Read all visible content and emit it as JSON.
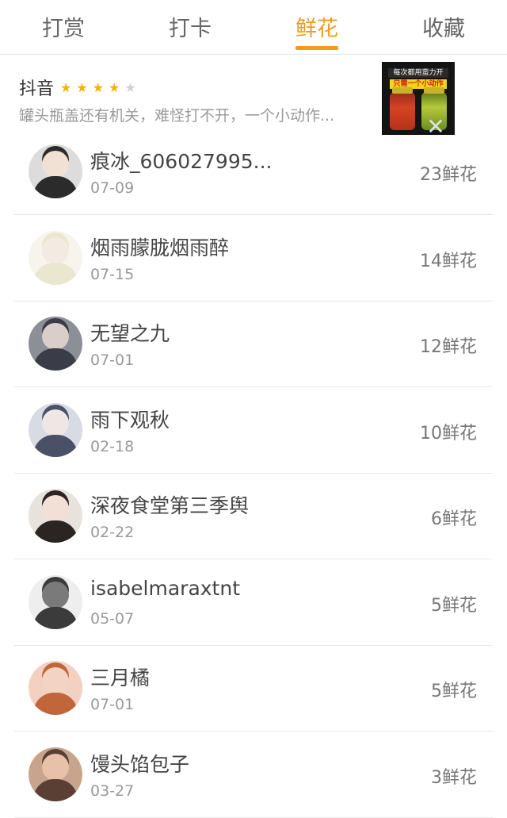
{
  "tabs": [
    {
      "label": "打赏",
      "active": false
    },
    {
      "label": "打卡",
      "active": false
    },
    {
      "label": "鲜花",
      "active": true
    },
    {
      "label": "收藏",
      "active": false
    }
  ],
  "ad": {
    "title": "抖音",
    "rating": 4,
    "rating_max": 5,
    "description": "罐头瓶盖还有机关，难怪打不开，一个小动作...",
    "thumb_caption_1": "每次都用蛮力开",
    "thumb_caption_2": "只需一个小动作",
    "close_icon": "close-icon"
  },
  "colors": {
    "accent": "#f39a1c",
    "star_on": "#f6b200",
    "star_off": "#d0d0d0"
  },
  "entries": [
    {
      "name": "痕冰_606027995...",
      "date": "07-09",
      "count": "23鲜花",
      "avatar_color": "#2b2b2b",
      "avatar_bg": "#dcdcdc",
      "avatar_skin": "#f1e0d4"
    },
    {
      "name": "烟雨朦胧烟雨醉",
      "date": "07-15",
      "count": "14鲜花",
      "avatar_color": "#eae7cf",
      "avatar_bg": "#f6f4ec",
      "avatar_skin": "#f3ebe2"
    },
    {
      "name": "无望之九",
      "date": "07-01",
      "count": "12鲜花",
      "avatar_color": "#3a3d48",
      "avatar_bg": "#8d8f96",
      "avatar_skin": "#d9cfc8"
    },
    {
      "name": "雨下观秋",
      "date": "02-18",
      "count": "10鲜花",
      "avatar_color": "#4a5066",
      "avatar_bg": "#d7dbe4",
      "avatar_skin": "#f0e6e4"
    },
    {
      "name": "深夜食堂第三季舆",
      "date": "02-22",
      "count": "6鲜花",
      "avatar_color": "#2a2422",
      "avatar_bg": "#e8e2dd",
      "avatar_skin": "#f2dfd5"
    },
    {
      "name": "isabelmaraxtnt",
      "date": "05-07",
      "count": "5鲜花",
      "avatar_color": "#3b3b3b",
      "avatar_bg": "#eeeeee",
      "avatar_skin": "#7a7a7a"
    },
    {
      "name": "三月橘",
      "date": "07-01",
      "count": "5鲜花",
      "avatar_color": "#c0663a",
      "avatar_bg": "#f3d1c2",
      "avatar_skin": "#f2d3c4"
    },
    {
      "name": "馒头馅包子",
      "date": "03-27",
      "count": "3鲜花",
      "avatar_color": "#5a4034",
      "avatar_bg": "#c9a48d",
      "avatar_skin": "#e7c1a8"
    }
  ]
}
